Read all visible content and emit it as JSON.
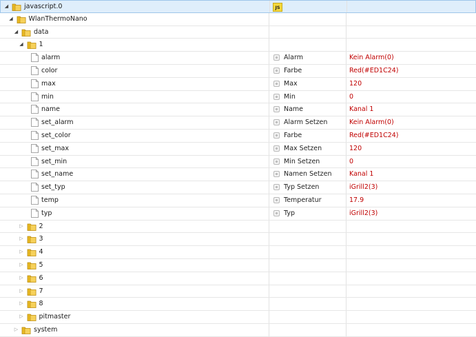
{
  "tree": [
    {
      "label": "javascript.0",
      "level": 0,
      "kind": "folder",
      "expanded": true,
      "selected": true,
      "badge": "JS",
      "badge_icon": "js-adapter-icon"
    },
    {
      "label": "WlanThermoNano",
      "level": 1,
      "kind": "folder",
      "expanded": true
    },
    {
      "label": "data",
      "level": 2,
      "kind": "folder",
      "expanded": true
    },
    {
      "label": "1",
      "level": 3,
      "kind": "folder",
      "expanded": true
    },
    {
      "label": "alarm",
      "level": 4,
      "kind": "state",
      "name": "Alarm",
      "value": "Kein Alarm(0)"
    },
    {
      "label": "color",
      "level": 4,
      "kind": "state",
      "name": "Farbe",
      "value": "Red(#ED1C24)"
    },
    {
      "label": "max",
      "level": 4,
      "kind": "state",
      "name": "Max",
      "value": "120"
    },
    {
      "label": "min",
      "level": 4,
      "kind": "state",
      "name": "Min",
      "value": "0"
    },
    {
      "label": "name",
      "level": 4,
      "kind": "state",
      "name": "Name",
      "value": "Kanal 1"
    },
    {
      "label": "set_alarm",
      "level": 4,
      "kind": "state",
      "name": "Alarm Setzen",
      "value": "Kein Alarm(0)"
    },
    {
      "label": "set_color",
      "level": 4,
      "kind": "state",
      "name": "Farbe",
      "value": "Red(#ED1C24)"
    },
    {
      "label": "set_max",
      "level": 4,
      "kind": "state",
      "name": "Max Setzen",
      "value": "120"
    },
    {
      "label": "set_min",
      "level": 4,
      "kind": "state",
      "name": "Min Setzen",
      "value": "0"
    },
    {
      "label": "set_name",
      "level": 4,
      "kind": "state",
      "name": "Namen Setzen",
      "value": "Kanal 1"
    },
    {
      "label": "set_typ",
      "level": 4,
      "kind": "state",
      "name": "Typ Setzen",
      "value": "iGrill2(3)"
    },
    {
      "label": "temp",
      "level": 4,
      "kind": "state",
      "name": "Temperatur",
      "value": "17.9"
    },
    {
      "label": "typ",
      "level": 4,
      "kind": "state",
      "name": "Typ",
      "value": "iGrill2(3)"
    },
    {
      "label": "2",
      "level": 3,
      "kind": "folder",
      "expanded": false
    },
    {
      "label": "3",
      "level": 3,
      "kind": "folder",
      "expanded": false
    },
    {
      "label": "4",
      "level": 3,
      "kind": "folder",
      "expanded": false
    },
    {
      "label": "5",
      "level": 3,
      "kind": "folder",
      "expanded": false
    },
    {
      "label": "6",
      "level": 3,
      "kind": "folder",
      "expanded": false
    },
    {
      "label": "7",
      "level": 3,
      "kind": "folder",
      "expanded": false
    },
    {
      "label": "8",
      "level": 3,
      "kind": "folder",
      "expanded": false
    },
    {
      "label": "pitmaster",
      "level": 3,
      "kind": "folder",
      "expanded": false
    },
    {
      "label": "system",
      "level": 2,
      "kind": "folder",
      "expanded": false
    }
  ],
  "icons": {
    "folder": "folder-icon",
    "state": "file-icon",
    "role": "state-role-icon",
    "expanded": "triangle-down-icon",
    "collapsed": "triangle-right-icon"
  },
  "colors": {
    "value_text": "#c00000",
    "folder_fill": "#e8b923",
    "selected_row": "#dfeefb",
    "js_badge": "#f5d83c"
  }
}
